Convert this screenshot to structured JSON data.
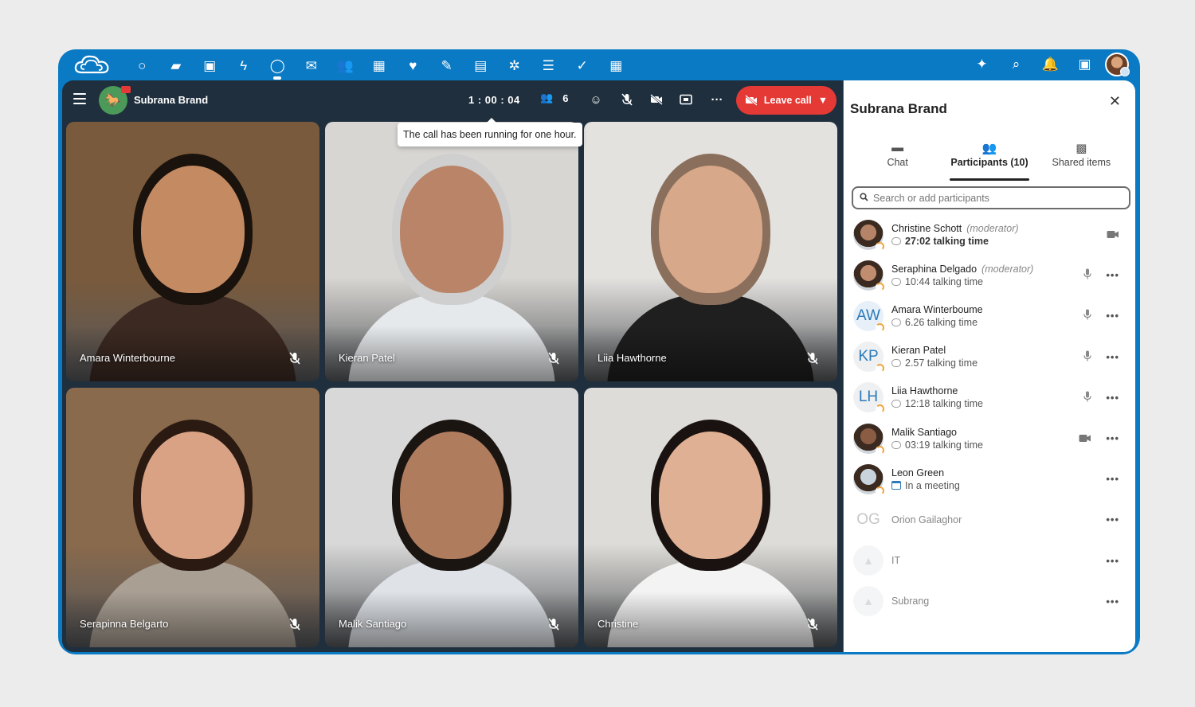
{
  "colors": {
    "brand": "#0a7ac4",
    "leave": "#e53935",
    "call_bg": "#1f2f3d"
  },
  "topbar": {
    "apps": [
      {
        "icon": "dashboard-icon",
        "glyph": "○"
      },
      {
        "icon": "files-icon",
        "glyph": "▰"
      },
      {
        "icon": "photos-icon",
        "glyph": "▣"
      },
      {
        "icon": "activity-icon",
        "glyph": "ϟ"
      },
      {
        "icon": "talk-icon",
        "glyph": "◯",
        "active": true
      },
      {
        "icon": "mail-icon",
        "glyph": "✉"
      },
      {
        "icon": "contacts-icon",
        "glyph": "👥"
      },
      {
        "icon": "calendar-icon",
        "glyph": "▦"
      },
      {
        "icon": "favorites-icon",
        "glyph": "♥"
      },
      {
        "icon": "notes-icon",
        "glyph": "✎"
      },
      {
        "icon": "deck-icon",
        "glyph": "▤"
      },
      {
        "icon": "apps-icon",
        "glyph": "✲"
      },
      {
        "icon": "tasks-icon",
        "glyph": "☰"
      },
      {
        "icon": "checkmark-icon",
        "glyph": "✓"
      },
      {
        "icon": "tables-icon",
        "glyph": "▦"
      }
    ],
    "right": [
      {
        "icon": "assistant-icon",
        "glyph": "✦"
      },
      {
        "icon": "search-icon",
        "glyph": "⌕"
      },
      {
        "icon": "notifications-icon",
        "glyph": "🔔"
      },
      {
        "icon": "contacts-menu-icon",
        "glyph": "▣"
      }
    ]
  },
  "call": {
    "room_name": "Subrana Brand",
    "timer": "1 : 00 : 04",
    "participant_count": "6",
    "leave_label": "Leave call",
    "tooltip": "The call has been running for one hour.",
    "tiles": [
      {
        "name": "Amara Winterbourne",
        "bg": "#7a5a3c",
        "skin": "#c48a62",
        "hair": "#1a120c",
        "cloth": "#3c2a22"
      },
      {
        "name": "Kieran Patel",
        "bg": "#d8d6d2",
        "skin": "#b98468",
        "hair": "#cfcfcf",
        "cloth": "#e6e9ec"
      },
      {
        "name": "Liia Hawthorne",
        "bg": "#e4e2df",
        "skin": "#d7a889",
        "hair": "#8a6f5c",
        "cloth": "#1f1f1f"
      },
      {
        "name": "Serapinna Belgarto",
        "bg": "#8a6a4c",
        "skin": "#d9a284",
        "hair": "#2a1a12",
        "cloth": "#a99f93"
      },
      {
        "name": "Malik Santiago",
        "bg": "#d8d8d8",
        "skin": "#b07c5e",
        "hair": "#1b1512",
        "cloth": "#dfe3e8"
      },
      {
        "name": "Christine",
        "bg": "#dedcd8",
        "skin": "#dfb093",
        "hair": "#1a1210",
        "cloth": "#f3f3f3"
      }
    ]
  },
  "sidebar": {
    "title": "Subrana Brand",
    "tabs": [
      {
        "label": "Chat",
        "glyph": "▬"
      },
      {
        "label": "Participants (10)",
        "glyph": "👥",
        "active": true
      },
      {
        "label": "Shared items",
        "glyph": "▩"
      }
    ],
    "search_placeholder": "Search or add participants",
    "participants": [
      {
        "name": "Christine Schott",
        "role": "(moderator)",
        "sub": "27:02 talking time",
        "bold": true,
        "avatar": "photo",
        "color": "#b58368",
        "initials": "",
        "actions": [
          "video"
        ]
      },
      {
        "name": "Seraphina Delgado",
        "role": "(moderator)",
        "sub": "10:44 talking time",
        "avatar": "photo",
        "color": "#c08d6e",
        "initials": "",
        "actions": [
          "mic",
          "more"
        ]
      },
      {
        "name": "Amara Winterboume",
        "role": "",
        "sub": "6.26 talking time",
        "avatar": "initials",
        "color": "#e7f0f8",
        "initials": "AW",
        "actions": [
          "mic",
          "more"
        ]
      },
      {
        "name": "Kieran Patel",
        "role": "",
        "sub": "2.57 talking time",
        "avatar": "initials",
        "color": "#eef0f2",
        "initials": "KP",
        "actions": [
          "mic",
          "more"
        ]
      },
      {
        "name": "Liia Hawthorne",
        "role": "",
        "sub": "12:18 talking time",
        "avatar": "initials",
        "color": "#eef0f2",
        "initials": "LH",
        "actions": [
          "mic",
          "more"
        ]
      },
      {
        "name": "Malik Santiago",
        "role": "",
        "sub": "03:19 talking time",
        "avatar": "photo",
        "color": "#8a5c44",
        "initials": "",
        "actions": [
          "video",
          "more"
        ]
      },
      {
        "name": "Leon Green",
        "role": "",
        "sub": "In a meeting",
        "avatar": "photo",
        "color": "#c9d3dc",
        "initials": "",
        "meeting": true,
        "actions": [
          "more"
        ]
      },
      {
        "name": "Orion Gailaghor",
        "role": "",
        "sub": "",
        "avatar": "initials",
        "color": "#ffffff",
        "initials": "OG",
        "faded": true,
        "actions": [
          "more"
        ]
      },
      {
        "name": "IT",
        "role": "",
        "sub": "",
        "avatar": "group",
        "color": "#eceeef",
        "initials": "",
        "faded": true,
        "actions": [
          "more"
        ]
      },
      {
        "name": "Subrang",
        "role": "",
        "sub": "",
        "avatar": "group",
        "color": "#eceeef",
        "initials": "",
        "faded": true,
        "actions": [
          "more"
        ]
      }
    ]
  }
}
